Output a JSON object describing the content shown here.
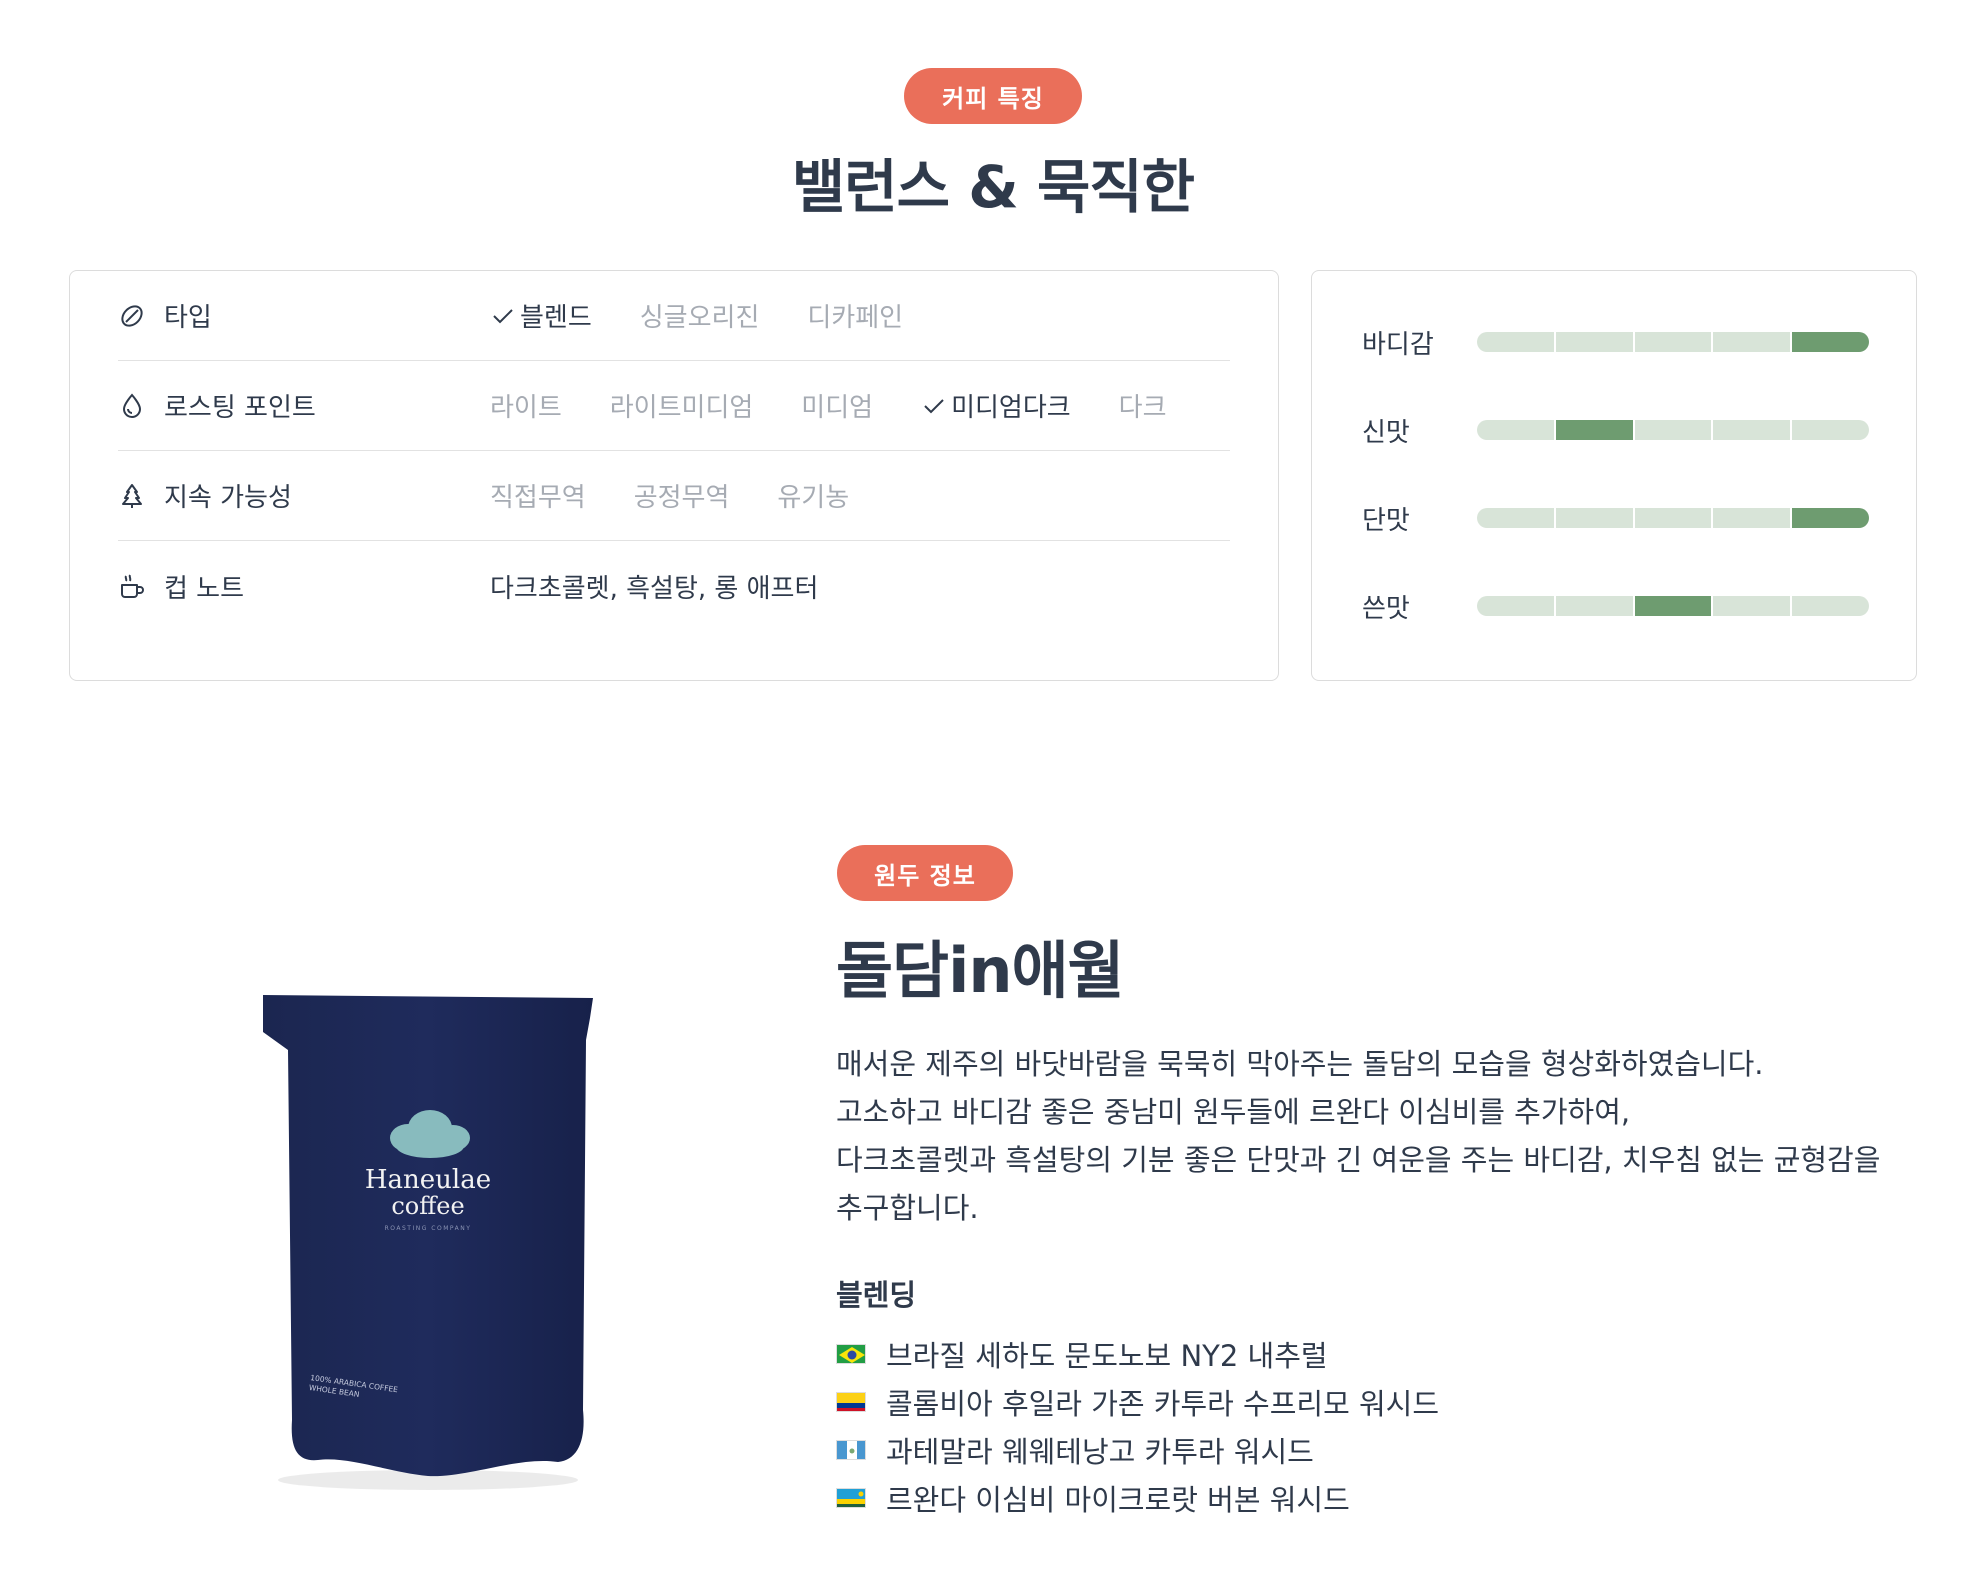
{
  "features": {
    "badge": "커피 특징",
    "title": "밸런스 & 묵직한",
    "attributes": [
      {
        "icon": "coffee-bean-icon",
        "label": "타입",
        "options": [
          {
            "label": "블렌드",
            "selected": true
          },
          {
            "label": "싱글오리진",
            "selected": false
          },
          {
            "label": "디카페인",
            "selected": false
          }
        ]
      },
      {
        "icon": "drop-icon",
        "label": "로스팅 포인트",
        "options": [
          {
            "label": "라이트",
            "selected": false
          },
          {
            "label": "라이트미디엄",
            "selected": false
          },
          {
            "label": "미디엄",
            "selected": false
          },
          {
            "label": "미디엄다크",
            "selected": true
          },
          {
            "label": "다크",
            "selected": false
          }
        ]
      },
      {
        "icon": "tree-icon",
        "label": "지속 가능성",
        "options": [
          {
            "label": "직접무역",
            "selected": false
          },
          {
            "label": "공정무역",
            "selected": false
          },
          {
            "label": "유기농",
            "selected": false
          }
        ]
      },
      {
        "icon": "cup-icon",
        "label": "컵 노트",
        "note": "다크초콜렛, 흑설탕, 롱 애프터"
      }
    ],
    "taste": [
      {
        "label": "바디감",
        "level": 5,
        "max": 5
      },
      {
        "label": "신맛",
        "level": 2,
        "max": 5
      },
      {
        "label": "단맛",
        "level": 5,
        "max": 5
      },
      {
        "label": "쓴맛",
        "level": 3,
        "max": 5
      }
    ],
    "colors": {
      "accent": "#ea6f5a",
      "bar_filled": "#6e9c70",
      "bar_empty": "#d8e4d8"
    }
  },
  "bean": {
    "badge": "원두 정보",
    "title": "돌담in애월",
    "description": [
      "매서운 제주의 바닷바람을 묵묵히 막아주는 돌담의 모습을 형상화하였습니다.",
      "고소하고 바디감 좋은 중남미 원두들에 르완다 이심비를 추가하여,",
      "다크초콜렛과 흑설탕의 기분 좋은 단맛과 긴 여운을 주는 바디감, 치우침 없는 균형감을",
      "추구합니다."
    ],
    "blend_title": "블렌딩",
    "blend": [
      {
        "flag": "brazil-flag-icon",
        "name": "브라질 세하도 문도노보 NY2 내추럴"
      },
      {
        "flag": "colombia-flag-icon",
        "name": "콜롬비아 후일라 가존 카투라 수프리모 워시드"
      },
      {
        "flag": "guatemala-flag-icon",
        "name": "과테말라 웨웨테낭고 카투라 워시드"
      },
      {
        "flag": "rwanda-flag-icon",
        "name": "르완다 이심비 마이크로랏 버본 워시드"
      }
    ],
    "package": {
      "brand_line1": "Haneulae",
      "brand_line2": "coffee",
      "brand_sub": "ROASTING COMPANY",
      "bottom_line1": "100% ARABICA COFFEE",
      "bottom_line2": "WHOLE BEAN"
    }
  }
}
